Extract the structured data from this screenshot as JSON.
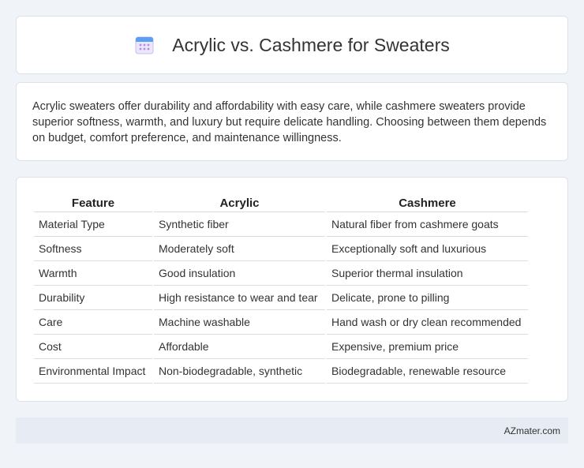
{
  "header": {
    "title": "Acrylic vs. Cashmere for Sweaters",
    "icon": "calendar-icon"
  },
  "description": "Acrylic sweaters offer durability and affordability with easy care, while cashmere sweaters provide superior softness, warmth, and luxury but require delicate handling. Choosing between them depends on budget, comfort preference, and maintenance willingness.",
  "table": {
    "headers": [
      "Feature",
      "Acrylic",
      "Cashmere"
    ],
    "rows": [
      [
        "Material Type",
        "Synthetic fiber",
        "Natural fiber from cashmere goats"
      ],
      [
        "Softness",
        "Moderately soft",
        "Exceptionally soft and luxurious"
      ],
      [
        "Warmth",
        "Good insulation",
        "Superior thermal insulation"
      ],
      [
        "Durability",
        "High resistance to wear and tear",
        "Delicate, prone to pilling"
      ],
      [
        "Care",
        "Machine washable",
        "Hand wash or dry clean recommended"
      ],
      [
        "Cost",
        "Affordable",
        "Expensive, premium price"
      ],
      [
        "Environmental Impact",
        "Non-biodegradable, synthetic",
        "Biodegradable, renewable resource"
      ]
    ]
  },
  "footer": {
    "brand": "AZmater.com"
  }
}
